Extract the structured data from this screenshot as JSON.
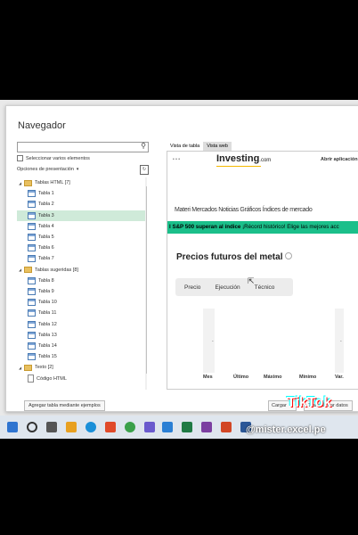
{
  "dialog": {
    "title": "Navegador",
    "search_placeholder": "",
    "multi_select_label": "Seleccionar varios elementos",
    "options_label": "Opciones de presentación",
    "tree": [
      {
        "type": "folder",
        "label": "Tablas HTML [7]"
      },
      {
        "type": "table",
        "label": "Tabla 1"
      },
      {
        "type": "table",
        "label": "Tabla 2"
      },
      {
        "type": "table",
        "label": "Tabla 3",
        "selected": true
      },
      {
        "type": "table",
        "label": "Tabla 4"
      },
      {
        "type": "table",
        "label": "Tabla 5"
      },
      {
        "type": "table",
        "label": "Tabla 6"
      },
      {
        "type": "table",
        "label": "Tabla 7"
      },
      {
        "type": "folder",
        "label": "Tablas sugeridas [8]"
      },
      {
        "type": "table",
        "label": "Tabla 8"
      },
      {
        "type": "table",
        "label": "Tabla 9"
      },
      {
        "type": "table",
        "label": "Tabla 10"
      },
      {
        "type": "table",
        "label": "Tabla 11"
      },
      {
        "type": "table",
        "label": "Tabla 12"
      },
      {
        "type": "table",
        "label": "Tabla 13"
      },
      {
        "type": "table",
        "label": "Tabla 14"
      },
      {
        "type": "table",
        "label": "Tabla 15"
      },
      {
        "type": "folder",
        "label": "Texto [2]"
      },
      {
        "type": "doc",
        "label": "Código HTML"
      }
    ],
    "tabs": {
      "table_view": "Vista de tabla",
      "web_view": "Vista web"
    },
    "buttons": {
      "add_table": "Agregar tabla mediante ejemplos",
      "load": "Cargar",
      "transform": "Transformar datos"
    }
  },
  "web": {
    "logo": "Investing",
    "logo_suffix": ".com",
    "open_app": "Abrir aplicación",
    "menu_text": "Materi Mercados Noticias Gráficos Índices de mercado",
    "banner_bold": "l S&P 500 superan al índice",
    "banner_text": " ¡Récord histórico! Elige las mejores acc",
    "futures_title": "Precios futuros del metal",
    "filters": [
      "Precio",
      "Ejecución",
      "Técnico"
    ],
    "columns": [
      "Mes",
      "Último",
      "Máximo",
      "Mínimo",
      "Var."
    ],
    "dash": "-"
  },
  "overlay": {
    "tiktok": "TikTok",
    "user": "@mister.excel.pe"
  },
  "colors": {
    "selected_row": "#cfead9",
    "banner": "#1bbf8a",
    "taskbar": "#dfe6ee"
  }
}
